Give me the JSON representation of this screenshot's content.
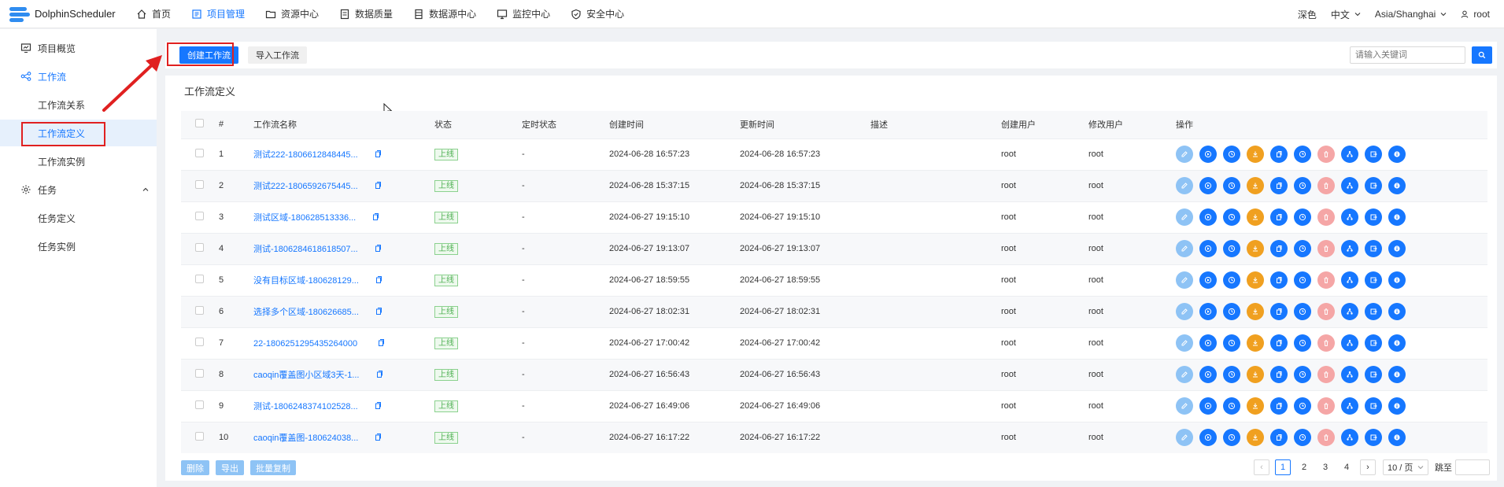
{
  "app": {
    "name": "DolphinScheduler"
  },
  "nav": {
    "items": [
      {
        "label": "首页",
        "icon": "home-icon"
      },
      {
        "label": "项目管理",
        "icon": "project-icon",
        "active": true
      },
      {
        "label": "资源中心",
        "icon": "folder-icon"
      },
      {
        "label": "数据质量",
        "icon": "data-quality-icon"
      },
      {
        "label": "数据源中心",
        "icon": "datasource-icon"
      },
      {
        "label": "监控中心",
        "icon": "monitor-icon"
      },
      {
        "label": "安全中心",
        "icon": "shield-icon"
      }
    ],
    "theme": "深色",
    "language": "中文",
    "timezone": "Asia/Shanghai",
    "user": "root"
  },
  "sidebar": {
    "items": [
      {
        "label": "项目概览",
        "icon": "overview-icon"
      },
      {
        "label": "工作流",
        "icon": "workflow-icon"
      },
      {
        "label": "工作流关系"
      },
      {
        "label": "工作流定义",
        "selected": true
      },
      {
        "label": "工作流实例"
      },
      {
        "label": "任务",
        "icon": "gear-icon"
      },
      {
        "label": "任务定义"
      },
      {
        "label": "任务实例"
      }
    ]
  },
  "toolbar": {
    "create_label": "创建工作流",
    "import_label": "导入工作流",
    "search_placeholder": "请输入关键词"
  },
  "card": {
    "title": "工作流定义"
  },
  "table": {
    "columns": [
      "#",
      "工作流名称",
      "状态",
      "定时状态",
      "创建时间",
      "更新时间",
      "描述",
      "创建用户",
      "修改用户",
      "操作"
    ],
    "rows": [
      {
        "index": "1",
        "name": "测试222-1806612848445...",
        "status": "上线",
        "schedule": "-",
        "created": "2024-06-28 16:57:23",
        "updated": "2024-06-28 16:57:23",
        "desc": "",
        "creator": "root",
        "modifier": "root"
      },
      {
        "index": "2",
        "name": "测试222-1806592675445...",
        "status": "上线",
        "schedule": "-",
        "created": "2024-06-28 15:37:15",
        "updated": "2024-06-28 15:37:15",
        "desc": "",
        "creator": "root",
        "modifier": "root"
      },
      {
        "index": "3",
        "name": "测试区域-180628513336...",
        "status": "上线",
        "schedule": "-",
        "created": "2024-06-27 19:15:10",
        "updated": "2024-06-27 19:15:10",
        "desc": "",
        "creator": "root",
        "modifier": "root"
      },
      {
        "index": "4",
        "name": "测试-1806284618618507...",
        "status": "上线",
        "schedule": "-",
        "created": "2024-06-27 19:13:07",
        "updated": "2024-06-27 19:13:07",
        "desc": "",
        "creator": "root",
        "modifier": "root"
      },
      {
        "index": "5",
        "name": "没有目标区域-180628129...",
        "status": "上线",
        "schedule": "-",
        "created": "2024-06-27 18:59:55",
        "updated": "2024-06-27 18:59:55",
        "desc": "",
        "creator": "root",
        "modifier": "root"
      },
      {
        "index": "6",
        "name": "选择多个区域-180626685...",
        "status": "上线",
        "schedule": "-",
        "created": "2024-06-27 18:02:31",
        "updated": "2024-06-27 18:02:31",
        "desc": "",
        "creator": "root",
        "modifier": "root"
      },
      {
        "index": "7",
        "name": "22-1806251295435264000",
        "status": "上线",
        "schedule": "-",
        "created": "2024-06-27 17:00:42",
        "updated": "2024-06-27 17:00:42",
        "desc": "",
        "creator": "root",
        "modifier": "root"
      },
      {
        "index": "8",
        "name": "caoqin覆盖图小区域3天-1...",
        "status": "上线",
        "schedule": "-",
        "created": "2024-06-27 16:56:43",
        "updated": "2024-06-27 16:56:43",
        "desc": "",
        "creator": "root",
        "modifier": "root"
      },
      {
        "index": "9",
        "name": "测试-1806248374102528...",
        "status": "上线",
        "schedule": "-",
        "created": "2024-06-27 16:49:06",
        "updated": "2024-06-27 16:49:06",
        "desc": "",
        "creator": "root",
        "modifier": "root"
      },
      {
        "index": "10",
        "name": "caoqin覆盖图-180624038...",
        "status": "上线",
        "schedule": "-",
        "created": "2024-06-27 16:17:22",
        "updated": "2024-06-27 16:17:22",
        "desc": "",
        "creator": "root",
        "modifier": "root"
      }
    ],
    "operations": [
      "edit-icon",
      "run-icon",
      "timing-icon",
      "download-icon",
      "copy-icon",
      "version-icon",
      "delete-icon",
      "tree-icon",
      "export-icon",
      "info-icon"
    ]
  },
  "footer": {
    "delete_label": "删除",
    "export_label": "导出",
    "batch_copy_label": "批量复制",
    "pages": [
      "1",
      "2",
      "3",
      "4"
    ],
    "current_page": "1",
    "page_size": "10 / 页",
    "jump_label": "跳至"
  },
  "colors": {
    "primary": "#1677ff",
    "pale_button": "#8ec3f5",
    "orange": "#f0a020",
    "danger_pale": "#f5a6a6",
    "status_green": "#4caf50",
    "annotation_red": "#e02020"
  }
}
